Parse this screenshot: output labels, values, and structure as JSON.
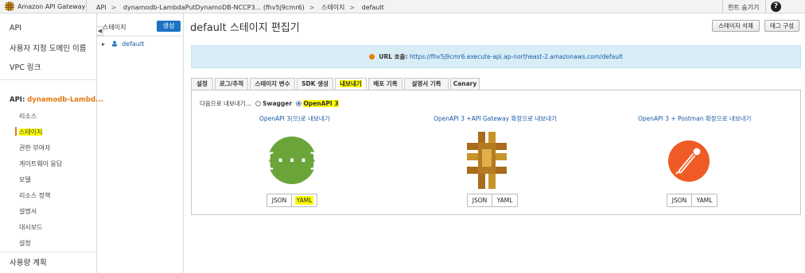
{
  "topbar": {
    "brand": "Amazon API Gateway",
    "breadcrumbs": [
      "API",
      "dynamodb-LambdaPutDynamoDB-NCCP3... (fhv5j9cmr6)",
      "스테이지",
      "default"
    ],
    "hide_hints": "힌트 숨기기",
    "help": "?"
  },
  "leftnav": {
    "items": [
      "API",
      "사용자 지정 도메인 이름",
      "VPC 링크"
    ],
    "api_label": "API:",
    "api_name": "dynamodb-Lambd...",
    "sub_items": [
      "리소스",
      "스테이지",
      "권한 부여자",
      "게이트웨이 응답",
      "모델",
      "리소스 정책",
      "설명서",
      "대시보드",
      "설정"
    ],
    "usage_plans": "사용량 계획"
  },
  "stages_panel": {
    "title": "스테이지",
    "create_label": "생성",
    "tree_item": "default"
  },
  "main": {
    "title": "default 스테이지 편집기",
    "delete_stage": "스테이지 삭제",
    "tag_config": "태그 구성",
    "url_label": "URL 호출:",
    "url": "https://fhv5j9cmr6.execute-api.ap-northeast-2.amazonaws.com/default",
    "tabs": [
      "설정",
      "로그/추적",
      "스테이지 변수",
      "SDK 생성",
      "내보내기",
      "배포 기록",
      "설명서 기록",
      "Canary"
    ],
    "active_tab": "내보내기",
    "export_as_label": "다음으로 내보내기...",
    "export_options": [
      "Swagger",
      "OpenAPI 3"
    ],
    "columns": [
      {
        "title": "OpenAPI 3(으)로 내보내기",
        "icon": "openapi-logo-icon",
        "buttons": [
          "JSON",
          "YAML"
        ]
      },
      {
        "title": "OpenAPI 3 +API Gateway 확장으로 내보내기",
        "icon": "api-gateway-logo-icon",
        "buttons": [
          "JSON",
          "YAML"
        ]
      },
      {
        "title": "OpenAPI 3 + Postman 확장으로 내보내기",
        "icon": "postman-logo-icon",
        "buttons": [
          "JSON",
          "YAML"
        ]
      }
    ]
  },
  "colors": {
    "accent_orange": "#e47911",
    "link_blue": "#1a5aa6",
    "highlight": "#ffff00",
    "openapi_green": "#6ba539",
    "apigw_gold": "#c8942a",
    "postman_orange": "#ef5b25"
  }
}
